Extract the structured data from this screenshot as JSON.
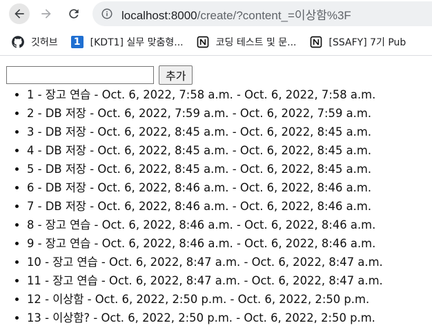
{
  "browser": {
    "url_host": "localhost:8000",
    "url_path": "/create/?content_=이상함%3F"
  },
  "bookmarks": [
    {
      "icon": "github-icon",
      "label": "깃허브"
    },
    {
      "icon": "numbered-1-icon",
      "icon_text": "1",
      "label": "[KDT1] 실무 맞춤형..."
    },
    {
      "icon": "notion-icon",
      "label": "코딩 테스트 및 문..."
    },
    {
      "icon": "notion-icon",
      "label": "[SSAFY] 7기 Pub"
    }
  ],
  "form": {
    "input_value": "",
    "submit_label": "추가"
  },
  "items": [
    {
      "text": "1 - 장고 연습 - Oct. 6, 2022, 7:58 a.m. - Oct. 6, 2022, 7:58 a.m."
    },
    {
      "text": "2 - DB 저장 - Oct. 6, 2022, 7:59 a.m. - Oct. 6, 2022, 7:59 a.m."
    },
    {
      "text": "3 - DB 저장 - Oct. 6, 2022, 8:45 a.m. - Oct. 6, 2022, 8:45 a.m."
    },
    {
      "text": "4 - DB 저장 - Oct. 6, 2022, 8:45 a.m. - Oct. 6, 2022, 8:45 a.m."
    },
    {
      "text": "5 - DB 저장 - Oct. 6, 2022, 8:45 a.m. - Oct. 6, 2022, 8:45 a.m."
    },
    {
      "text": "6 - DB 저장 - Oct. 6, 2022, 8:46 a.m. - Oct. 6, 2022, 8:46 a.m."
    },
    {
      "text": "7 - DB 저장 - Oct. 6, 2022, 8:46 a.m. - Oct. 6, 2022, 8:46 a.m."
    },
    {
      "text": "8 - 장고 연습 - Oct. 6, 2022, 8:46 a.m. - Oct. 6, 2022, 8:46 a.m."
    },
    {
      "text": "9 - 장고 연습 - Oct. 6, 2022, 8:46 a.m. - Oct. 6, 2022, 8:46 a.m."
    },
    {
      "text": "10 - 장고 연습 - Oct. 6, 2022, 8:47 a.m. - Oct. 6, 2022, 8:47 a.m."
    },
    {
      "text": "11 - 장고 연습 - Oct. 6, 2022, 8:47 a.m. - Oct. 6, 2022, 8:47 a.m."
    },
    {
      "text": "12 - 이상함 - Oct. 6, 2022, 2:50 p.m. - Oct. 6, 2022, 2:50 p.m."
    },
    {
      "text": "13 - 이상함? - Oct. 6, 2022, 2:50 p.m. - Oct. 6, 2022, 2:50 p.m."
    }
  ]
}
